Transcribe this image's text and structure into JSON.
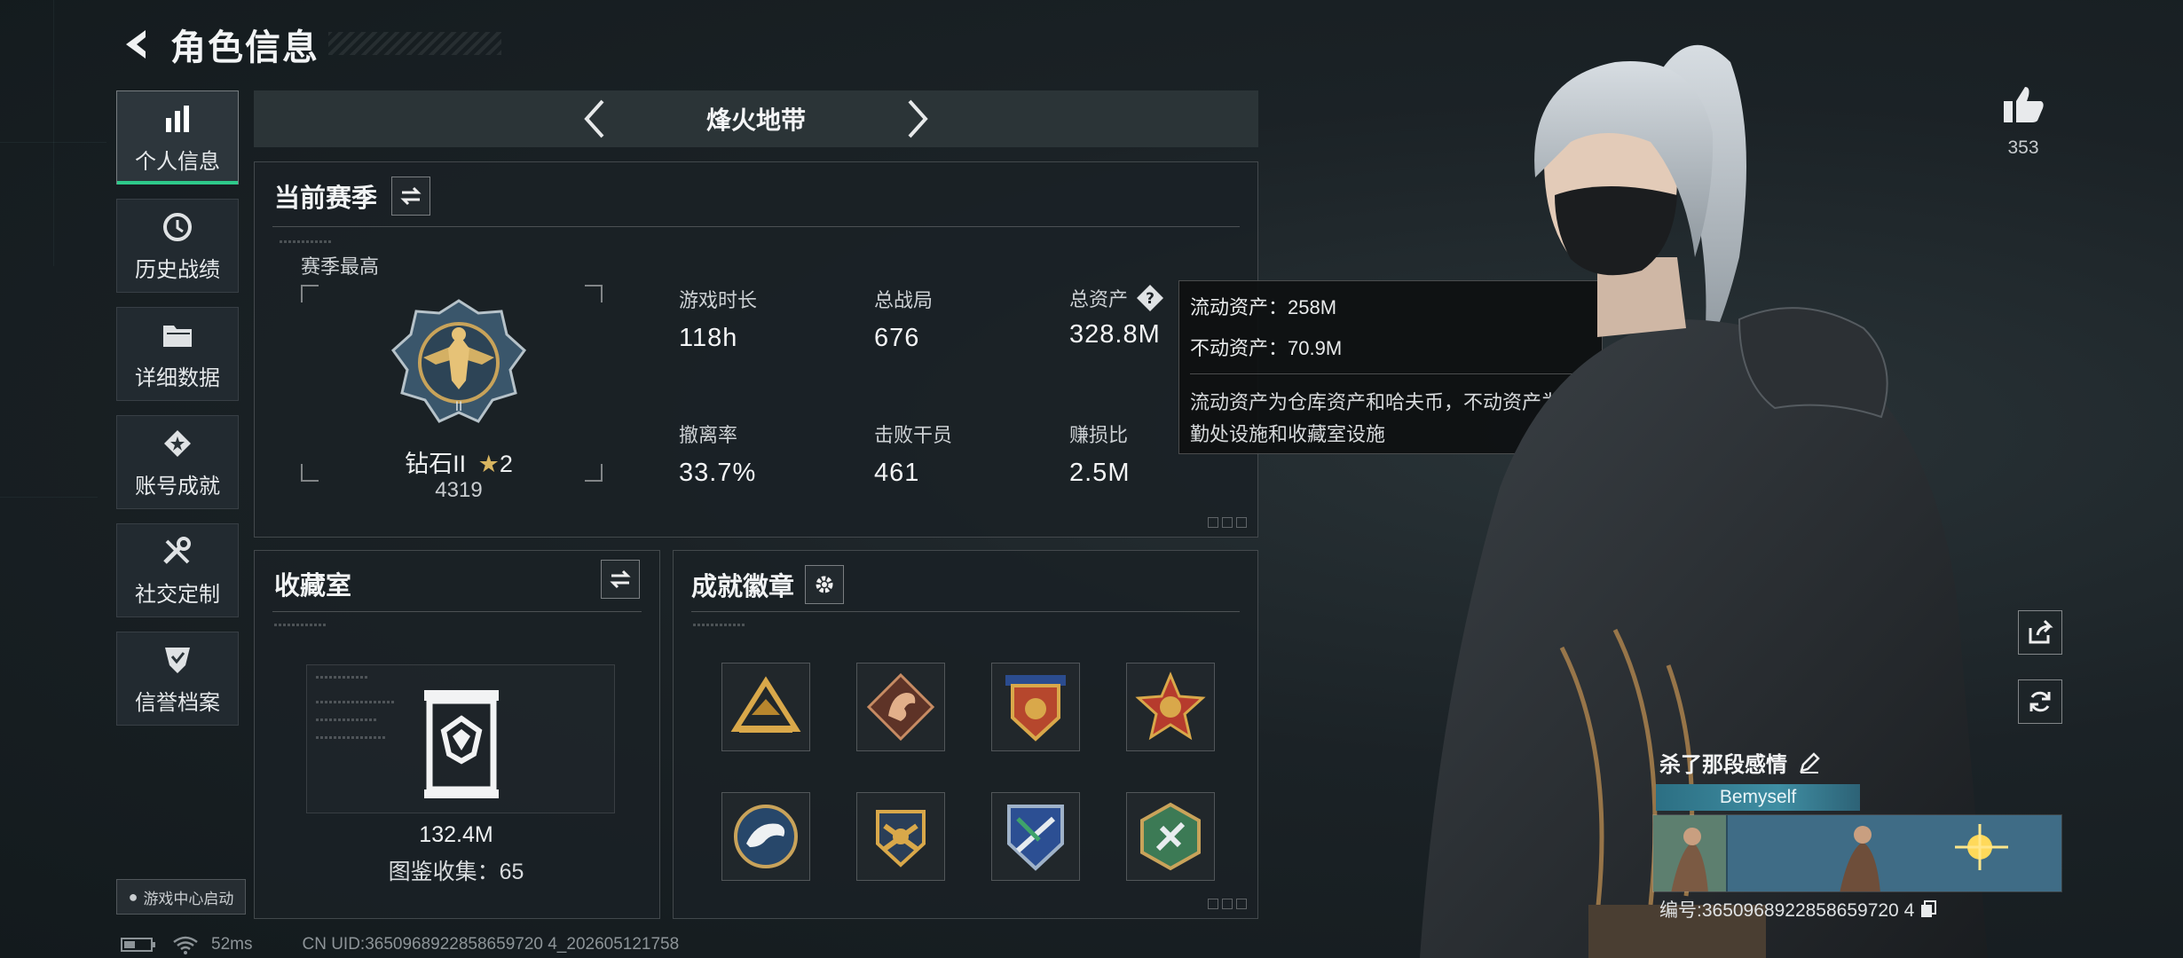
{
  "header": {
    "title": "角色信息"
  },
  "sidebar": {
    "items": [
      {
        "label": "个人信息",
        "icon": "bar-chart-icon",
        "active": true
      },
      {
        "label": "历史战绩",
        "icon": "history-clock-icon",
        "active": false
      },
      {
        "label": "详细数据",
        "icon": "folder-icon",
        "active": false
      },
      {
        "label": "账号成就",
        "icon": "achievement-star-icon",
        "active": false
      },
      {
        "label": "社交定制",
        "icon": "tools-icon",
        "active": false
      },
      {
        "label": "信誉档案",
        "icon": "shield-check-icon",
        "active": false
      }
    ],
    "game_center": "游戏中心启动"
  },
  "mode": {
    "title": "烽火地带"
  },
  "season": {
    "title": "当前赛季",
    "peak_label": "赛季最高",
    "rank_name": "钻石II",
    "rank_stars": "2",
    "rank_score": "4319",
    "stats": [
      {
        "label": "游戏时长",
        "value": "118h"
      },
      {
        "label": "总战局",
        "value": "676"
      },
      {
        "label": "总资产",
        "value": "328.8M"
      },
      {
        "label": "撤离率",
        "value": "33.7%"
      },
      {
        "label": "击败干员",
        "value": "461"
      },
      {
        "label": "赚损比",
        "value": "2.5M"
      }
    ]
  },
  "tooltip": {
    "line1": "流动资产：258M",
    "line2": "不动资产：70.9M",
    "description": "流动资产为仓库资产和哈夫币，不动资产为特勤处设施和收藏室设施"
  },
  "collection": {
    "title": "收藏室",
    "value": "132.4M",
    "count_text": "图鉴收集：65"
  },
  "badges": {
    "title": "成就徽章",
    "items": [
      {
        "name": "gold-triangle-badge"
      },
      {
        "name": "dragon-badge"
      },
      {
        "name": "shield-stars-badge"
      },
      {
        "name": "red-medal-badge"
      },
      {
        "name": "eagle-badge"
      },
      {
        "name": "crossed-wings-badge"
      },
      {
        "name": "blue-shield-badge"
      },
      {
        "name": "green-hex-badge"
      }
    ]
  },
  "likes": {
    "count": "353"
  },
  "player": {
    "name": "杀了那段感情",
    "tag": "Bemyself",
    "id_text": "编号:3650968922858659720 4"
  },
  "status": {
    "ping": "52ms",
    "uid": "CN UID:3650968922858659720 4_202605121758"
  },
  "colors": {
    "accent": "#2ec98a",
    "tag": "#3f8ea3"
  }
}
